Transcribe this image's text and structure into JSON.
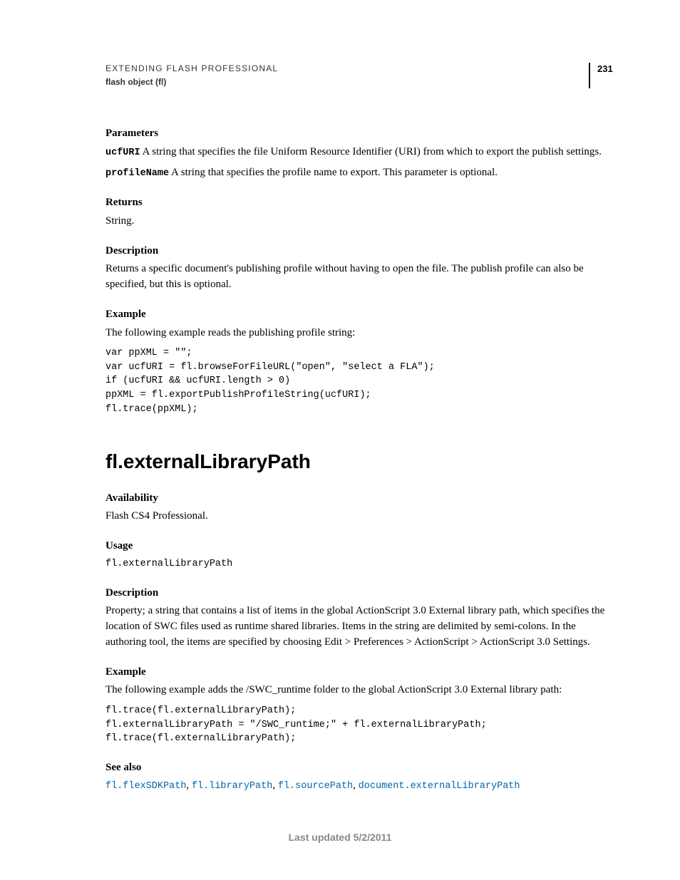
{
  "header": {
    "title": "EXTENDING FLASH PROFESSIONAL",
    "subtitle": "flash object (fl)",
    "pageNumber": "231"
  },
  "sec1": {
    "parametersHeading": "Parameters",
    "param1_name": "ucfURI",
    "param1_desc": "  A string that specifies the file Uniform Resource Identifier (URI) from which to export the publish settings.",
    "param2_name": "profileName",
    "param2_desc": "  A string that specifies the profile name to export. This parameter is optional.",
    "returnsHeading": "Returns",
    "returnsText": "String.",
    "descriptionHeading": "Description",
    "descriptionText": "Returns a specific document's publishing profile without having to open the file. The publish profile can also be specified, but this is optional.",
    "exampleHeading": "Example",
    "exampleIntro": "The following example reads the publishing profile string:",
    "exampleCode": "var ppXML = \"\";\nvar ucfURI = fl.browseForFileURL(\"open\", \"select a FLA\");\nif (ucfURI && ucfURI.length > 0)\nppXML = fl.exportPublishProfileString(ucfURI);\nfl.trace(ppXML);"
  },
  "sec2": {
    "title": "fl.externalLibraryPath",
    "availabilityHeading": "Availability",
    "availabilityText": "Flash CS4 Professional.",
    "usageHeading": "Usage",
    "usageCode": "fl.externalLibraryPath",
    "descriptionHeading": "Description",
    "descriptionText": "Property; a string that contains a list of items in the global ActionScript 3.0 External library path, which specifies the location of SWC files used as runtime shared libraries. Items in the string are delimited by semi-colons. In the authoring tool, the items are specified by choosing Edit > Preferences > ActionScript > ActionScript 3.0 Settings.",
    "exampleHeading": "Example",
    "exampleIntro": "The following example adds the /SWC_runtime folder to the global ActionScript 3.0 External library path:",
    "exampleCode": "fl.trace(fl.externalLibraryPath);\nfl.externalLibraryPath = \"/SWC_runtime;\" + fl.externalLibraryPath;\nfl.trace(fl.externalLibraryPath);",
    "seeAlsoHeading": "See also",
    "links": {
      "l1": "fl.flexSDKPath",
      "l2": "fl.libraryPath",
      "l3": "fl.sourcePath",
      "l4": "document.externalLibraryPath",
      "sep": ", "
    }
  },
  "footer": "Last updated 5/2/2011"
}
